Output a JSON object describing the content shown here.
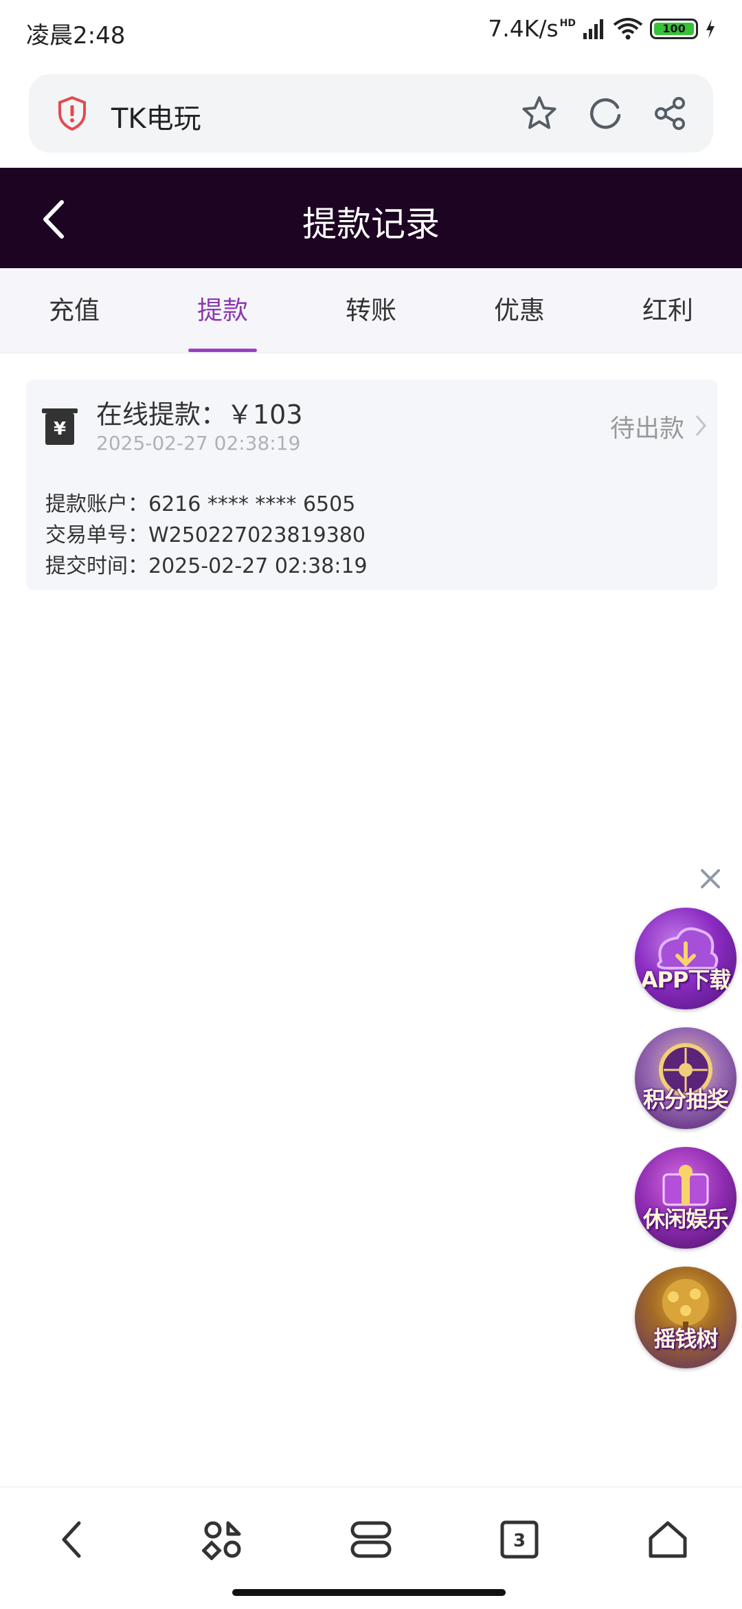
{
  "status_bar": {
    "time": "凌晨2:48",
    "net_speed": "7.4K/s",
    "hd": "HD",
    "battery": "100"
  },
  "browser": {
    "title": "TK电玩"
  },
  "header": {
    "title": "提款记录"
  },
  "tabs": [
    {
      "label": "充值",
      "active": false
    },
    {
      "label": "提款",
      "active": true
    },
    {
      "label": "转账",
      "active": false
    },
    {
      "label": "优惠",
      "active": false
    },
    {
      "label": "红利",
      "active": false
    }
  ],
  "record": {
    "title": "在线提款：￥103",
    "date": "2025-02-27 02:38:19",
    "status": "待出款",
    "details": [
      "提款账户：6216 **** **** 6505",
      "交易单号：W250227023819380",
      "提交时间：2025-02-27 02:38:19"
    ]
  },
  "floating": [
    {
      "label": "APP下载"
    },
    {
      "label": "积分抽奖"
    },
    {
      "label": "休闲娱乐"
    },
    {
      "label": "摇钱树"
    }
  ],
  "bottom_nav": {
    "tabs_count": "3"
  },
  "colors": {
    "header_bg": "#1c0422",
    "accent": "#9b3fc4",
    "card_bg": "#f5f6fa"
  }
}
